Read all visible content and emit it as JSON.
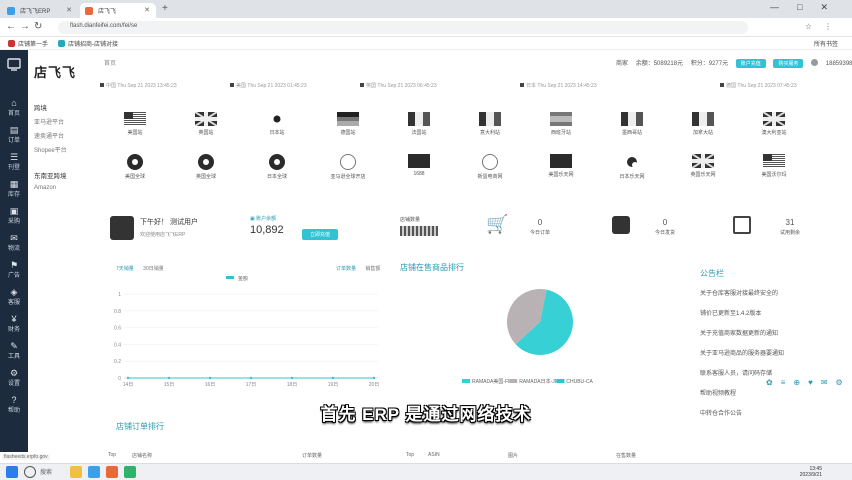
{
  "browser": {
    "tabs": [
      {
        "label": "店飞飞ERP"
      },
      {
        "label": "店飞飞"
      }
    ],
    "url": "flash.dianfeifei.com/fei/se",
    "bookmarks": [
      {
        "label": "店铺第一手"
      },
      {
        "label": "店铺招商-店铺对接"
      }
    ],
    "bookmark_right": "所有书签"
  },
  "app": {
    "logo": "店飞飞",
    "breadcrumb": "首页",
    "header": {
      "company": "商家",
      "balance": "余额：5089218元",
      "points": "积分：9277元",
      "btn1": "账户充值",
      "btn2": "购买服务",
      "phone": "18859398888"
    }
  },
  "clocks": [
    "中国 Thu Sep 21 2023 13:45:23",
    "美国 Thu Sep 21 2023 01:45:23",
    "英国 Thu Sep 21 2023 06:45:23",
    "日本 Thu Sep 21 2023 14:45:23",
    "德国 Thu Sep 21 2023 07:45:23"
  ],
  "sidebar": {
    "items": [
      {
        "icon": "⌂",
        "label": "首页"
      },
      {
        "icon": "▤",
        "label": "订单"
      },
      {
        "icon": "☰",
        "label": "刊登"
      },
      {
        "icon": "▦",
        "label": "库存"
      },
      {
        "icon": "▣",
        "label": "采购"
      },
      {
        "icon": "✉",
        "label": "物流"
      },
      {
        "icon": "⚑",
        "label": "广告"
      },
      {
        "icon": "◈",
        "label": "客服"
      },
      {
        "icon": "¥",
        "label": "财务"
      },
      {
        "icon": "✎",
        "label": "工具"
      },
      {
        "icon": "⚙",
        "label": "设置"
      },
      {
        "icon": "?",
        "label": "帮助"
      }
    ]
  },
  "side_menu": {
    "group1": "跨境",
    "items1": [
      "亚马逊平台",
      "速卖通平台",
      "Shopee平台"
    ],
    "group2": "东南亚跨境",
    "items2": [
      "Amazon"
    ]
  },
  "platforms_row1": [
    {
      "label": "美国站",
      "flag": "us"
    },
    {
      "label": "英国站",
      "flag": "uk"
    },
    {
      "label": "日本站",
      "flag": "jp"
    },
    {
      "label": "德国站",
      "flag": "de"
    },
    {
      "label": "法国站",
      "flag": "fr"
    },
    {
      "label": "意大利站",
      "flag": "it"
    },
    {
      "label": "西班牙站",
      "flag": "es"
    },
    {
      "label": "墨西哥站",
      "flag": "mx"
    },
    {
      "label": "加拿大站",
      "flag": "ca"
    },
    {
      "label": "澳大利亚站",
      "flag": "au"
    }
  ],
  "platforms_row2": [
    {
      "label": "美国全球",
      "icon": "pin"
    },
    {
      "label": "英国全球",
      "icon": "pin"
    },
    {
      "label": "日本全球",
      "icon": "pin"
    },
    {
      "label": "亚马逊全球开店",
      "icon": "circle"
    },
    {
      "label": "1688",
      "icon": "square"
    },
    {
      "label": "新蛋电商网",
      "icon": "circle"
    },
    {
      "label": "美国乐天网",
      "icon": "square"
    },
    {
      "label": "日本乐天网",
      "icon": "dot"
    },
    {
      "label": "英国乐天网",
      "icon": "uk"
    },
    {
      "label": "美国沃尔玛",
      "icon": "us"
    }
  ],
  "stats": {
    "greeting": "下午好！ 测试用户",
    "greeting_sub": "欢迎使用店飞飞ERP",
    "balance_label": "账户余额",
    "balance_value": "10,892",
    "recharge": "立即充值",
    "store_label": "店铺数量",
    "orders_today_value": "0",
    "orders_today_label": "今日订单",
    "shipped_value": "0",
    "shipped_label": "今日发货",
    "days_value": "31",
    "days_label": "试用剩余"
  },
  "sales_chart": {
    "tab1": "7天销量",
    "tab2": "30日销量",
    "opt1": "订单数量",
    "opt2": "销售额",
    "legend": "金额"
  },
  "chart_data": [
    {
      "type": "line",
      "x": [
        "14日",
        "15日",
        "16日",
        "17日",
        "18日",
        "19日",
        "20日"
      ],
      "series": [
        {
          "name": "金额",
          "values": [
            0,
            0,
            0,
            0,
            0,
            0,
            0
          ]
        }
      ],
      "ylim": [
        0,
        1
      ],
      "yticks": [
        "0",
        "0.2",
        "0.4",
        "0.6",
        "0.8",
        "1"
      ],
      "grid": true
    },
    {
      "type": "pie",
      "title": "店铺在售商品排行",
      "slices": [
        {
          "name": "RAMADA美国-FR",
          "value": 60,
          "color": "#37d0d4"
        },
        {
          "name": "RAMADA日本-JP",
          "value": 40,
          "color": "#b8b2b4"
        }
      ],
      "legend_extra": [
        "CHUBU-CA"
      ],
      "legend_placement": "bottom"
    }
  ],
  "notice": {
    "title": "公告栏",
    "items": [
      "关于仓库客服对接最终安全的",
      "铺价已更新至1.4.2版本",
      "关于充值商家数据更新的通知",
      "关于亚马逊商品的服务器要通知",
      "联系客服人员，请问码存储",
      "帮助视频教程",
      "中转仓合作公告"
    ]
  },
  "order_rank_title": "店铺订单排行",
  "table_headers": [
    "Top",
    "店铺名称",
    "订单数量",
    "Top",
    "ASIN",
    "图片",
    "在售数量"
  ],
  "subtitle": "首先 ERP 是通过网络技术",
  "status_url": "flasheeds.erpfo.gov",
  "taskbar": {
    "search": "搜索",
    "time": "13:45",
    "date": "2023/9/21"
  }
}
